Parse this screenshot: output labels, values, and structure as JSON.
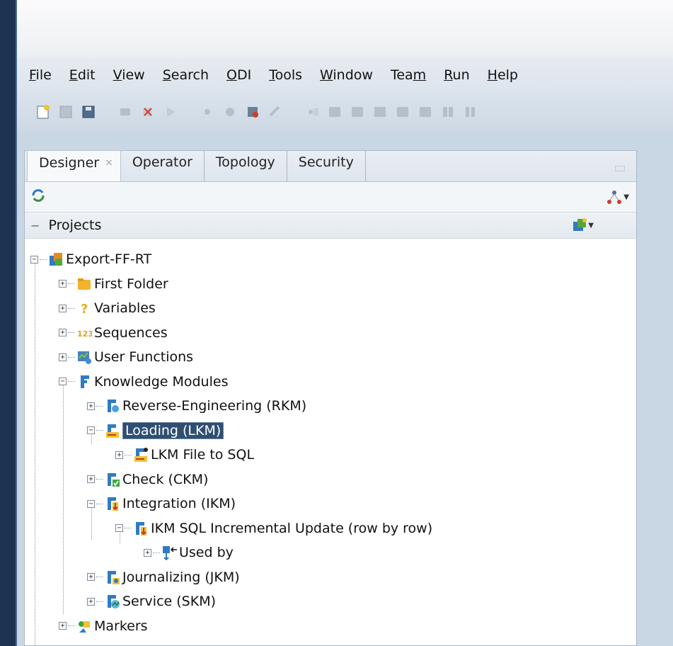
{
  "menu": [
    {
      "label": "File",
      "u": 0
    },
    {
      "label": "Edit",
      "u": 0
    },
    {
      "label": "View",
      "u": 0
    },
    {
      "label": "Search",
      "u": 0
    },
    {
      "label": "ODI",
      "u": 0
    },
    {
      "label": "Tools",
      "u": 0
    },
    {
      "label": "Window",
      "u": 0
    },
    {
      "label": "Team",
      "u": 3
    },
    {
      "label": "Run",
      "u": 0
    },
    {
      "label": "Help",
      "u": 0
    }
  ],
  "tabs": {
    "designer": "Designer",
    "designer_close": "×",
    "operator": "Operator",
    "topology": "Topology",
    "security": "Security"
  },
  "section": {
    "title": "Projects",
    "collapse_glyph": "−"
  },
  "tree": {
    "root": "Export-FF-RT",
    "first_folder": "First Folder",
    "variables": "Variables",
    "sequences": "Sequences",
    "user_functions": "User Functions",
    "knowledge_modules": "Knowledge Modules",
    "rkm": "Reverse-Engineering (RKM)",
    "lkm": "Loading (LKM)",
    "lkm_file_to_sql": "LKM File to SQL",
    "ckm": "Check (CKM)",
    "ikm": "Integration (IKM)",
    "ikm_sql_incremental": "IKM SQL Incremental Update (row by row)",
    "used_by": "Used by",
    "jkm": "Journalizing (JKM)",
    "skm": "Service (SKM)",
    "markers": "Markers"
  },
  "colors": {
    "selection": "#2f4f72",
    "desktop": "#1c3452"
  }
}
